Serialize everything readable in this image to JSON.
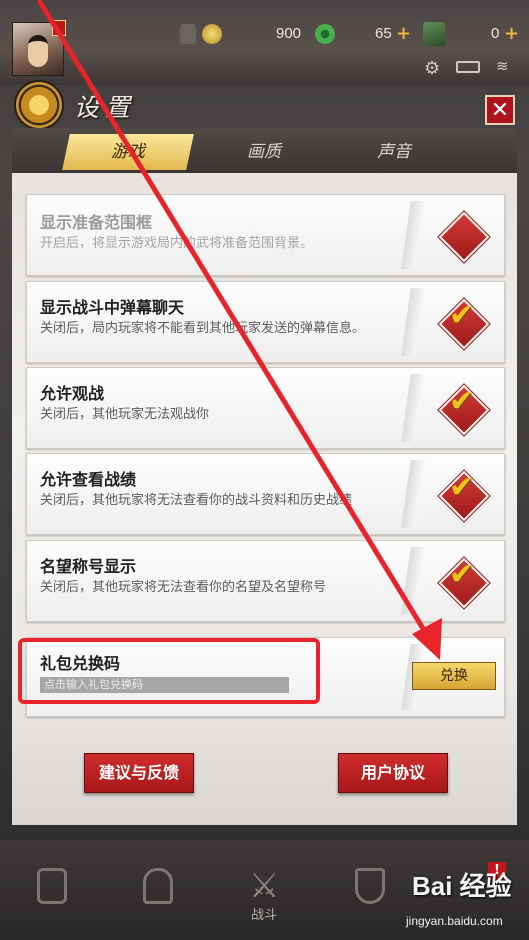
{
  "hud": {
    "currency1": "900",
    "currency2": "65",
    "currency3": "0",
    "plus": "+",
    "accent": "#f0b43c"
  },
  "dialog": {
    "title": "设置",
    "close": "✕",
    "tabs": [
      {
        "label": "游戏",
        "active": true
      },
      {
        "label": "画质",
        "active": false
      },
      {
        "label": "声音",
        "active": false
      }
    ],
    "rows": [
      {
        "title": "显示准备范围框",
        "desc": "开启后，将显示游戏局内的武将准备范围背景。",
        "state": "off",
        "disabled": true
      },
      {
        "title": "显示战斗中弹幕聊天",
        "desc": "关闭后，局内玩家将不能看到其他玩家发送的弹幕信息。",
        "state": "on",
        "disabled": false
      },
      {
        "title": "允许观战",
        "desc": "关闭后，其他玩家无法观战你",
        "state": "on",
        "disabled": false
      },
      {
        "title": "允许查看战绩",
        "desc": "关闭后，其他玩家将无法查看你的战斗资料和历史战绩",
        "state": "on",
        "disabled": false
      },
      {
        "title": "名望称号显示",
        "desc": "关闭后，其他玩家将无法查看你的名望及名望称号",
        "state": "on",
        "disabled": false
      }
    ],
    "redeem": {
      "title": "礼包兑换码",
      "placeholder": "点击输入礼包兑换码",
      "button": "兑换"
    },
    "feedback_button": "建议与反馈",
    "agreement_button": "用户协议"
  },
  "nav": {
    "battle_label": "战斗",
    "alert": "!"
  },
  "watermark": {
    "logo": "Bai 经验",
    "url": "jingyan.baidu.com"
  },
  "colors": {
    "annotation_red": "#e8232a",
    "toggle_red": "#c62a2a",
    "check_gold": "#f2c21b"
  }
}
